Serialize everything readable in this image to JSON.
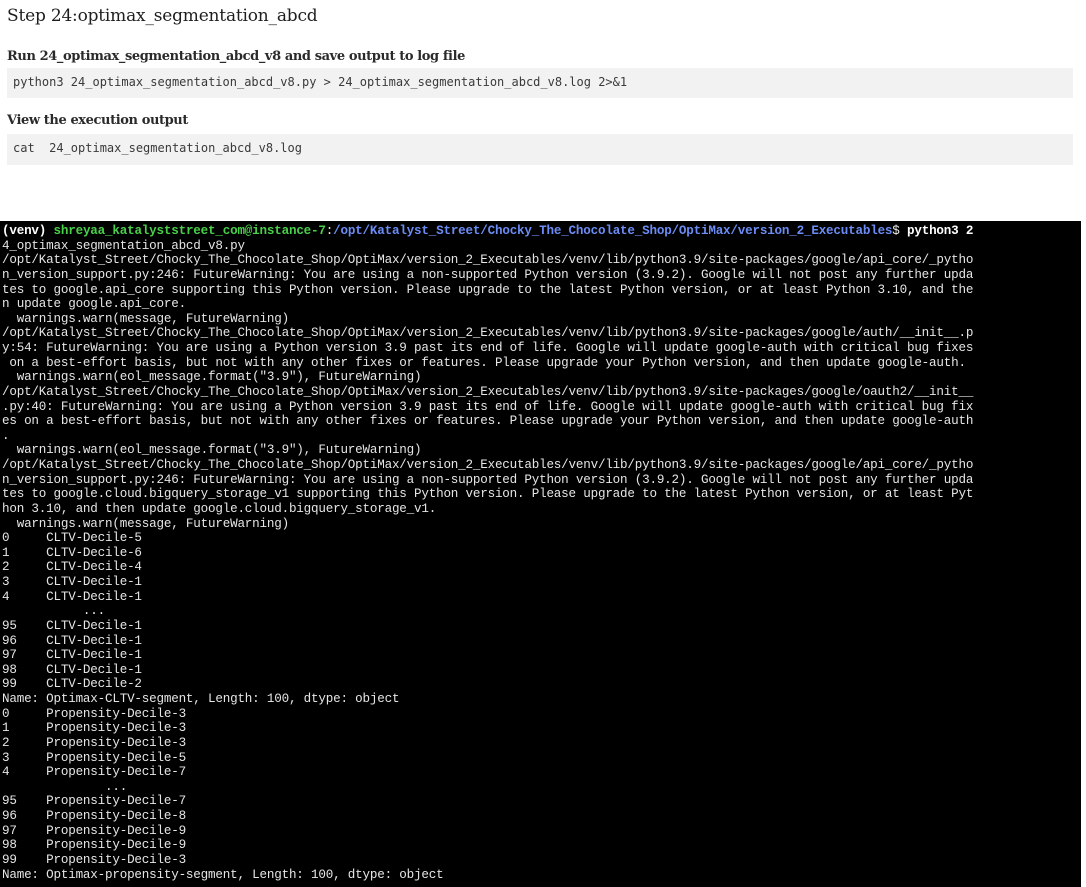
{
  "step": {
    "title": "Step 24:optimax_segmentation_abcd"
  },
  "run_section": {
    "heading": "Run 24_optimax_segmentation_abcd_v8 and save output to log file",
    "command": "python3 24_optimax_segmentation_abcd_v8.py > 24_optimax_segmentation_abcd_v8.log 2>&1"
  },
  "view_section": {
    "heading": "View the execution output",
    "command": "cat  24_optimax_segmentation_abcd_v8.log"
  },
  "terminal": {
    "colors": {
      "background": "#000000",
      "user": "#49d04a",
      "path": "#6c8cf5",
      "text": "#e6e6e6"
    },
    "prompt": {
      "env": "(venv) ",
      "user_host": "shreyaa_katalyststreet_com@instance-7",
      "colon": ":",
      "path": "/opt/Katalyst_Street/Chocky_The_Chocolate_Shop/OptiMax/version_2_Executables",
      "symbol": "$ ",
      "command": "python3 2"
    },
    "lines": [
      "4_optimax_segmentation_abcd_v8.py",
      "/opt/Katalyst_Street/Chocky_The_Chocolate_Shop/OptiMax/version_2_Executables/venv/lib/python3.9/site-packages/google/api_core/_pytho",
      "n_version_support.py:246: FutureWarning: You are using a non-supported Python version (3.9.2). Google will not post any further upda",
      "tes to google.api_core supporting this Python version. Please upgrade to the latest Python version, or at least Python 3.10, and the",
      "n update google.api_core.",
      "  warnings.warn(message, FutureWarning)",
      "/opt/Katalyst_Street/Chocky_The_Chocolate_Shop/OptiMax/version_2_Executables/venv/lib/python3.9/site-packages/google/auth/__init__.p",
      "y:54: FutureWarning: You are using a Python version 3.9 past its end of life. Google will update google-auth with critical bug fixes",
      " on a best-effort basis, but not with any other fixes or features. Please upgrade your Python version, and then update google-auth.",
      "  warnings.warn(eol_message.format(\"3.9\"), FutureWarning)",
      "/opt/Katalyst_Street/Chocky_The_Chocolate_Shop/OptiMax/version_2_Executables/venv/lib/python3.9/site-packages/google/oauth2/__init__",
      ".py:40: FutureWarning: You are using a Python version 3.9 past its end of life. Google will update google-auth with critical bug fix",
      "es on a best-effort basis, but not with any other fixes or features. Please upgrade your Python version, and then update google-auth",
      ".",
      "  warnings.warn(eol_message.format(\"3.9\"), FutureWarning)",
      "/opt/Katalyst_Street/Chocky_The_Chocolate_Shop/OptiMax/version_2_Executables/venv/lib/python3.9/site-packages/google/api_core/_pytho",
      "n_version_support.py:246: FutureWarning: You are using a non-supported Python version (3.9.2). Google will not post any further upda",
      "tes to google.cloud.bigquery_storage_v1 supporting this Python version. Please upgrade to the latest Python version, or at least Pyt",
      "hon 3.10, and then update google.cloud.bigquery_storage_v1.",
      "  warnings.warn(message, FutureWarning)",
      "0     CLTV-Decile-5",
      "1     CLTV-Decile-6",
      "2     CLTV-Decile-4",
      "3     CLTV-Decile-1",
      "4     CLTV-Decile-1",
      "           ...",
      "95    CLTV-Decile-1",
      "96    CLTV-Decile-1",
      "97    CLTV-Decile-1",
      "98    CLTV-Decile-1",
      "99    CLTV-Decile-2",
      "Name: Optimax-CLTV-segment, Length: 100, dtype: object",
      "0     Propensity-Decile-3",
      "1     Propensity-Decile-3",
      "2     Propensity-Decile-3",
      "3     Propensity-Decile-5",
      "4     Propensity-Decile-7",
      "              ...",
      "95    Propensity-Decile-7",
      "96    Propensity-Decile-8",
      "97    Propensity-Decile-9",
      "98    Propensity-Decile-9",
      "99    Propensity-Decile-3",
      "Name: Optimax-propensity-segment, Length: 100, dtype: object"
    ]
  }
}
